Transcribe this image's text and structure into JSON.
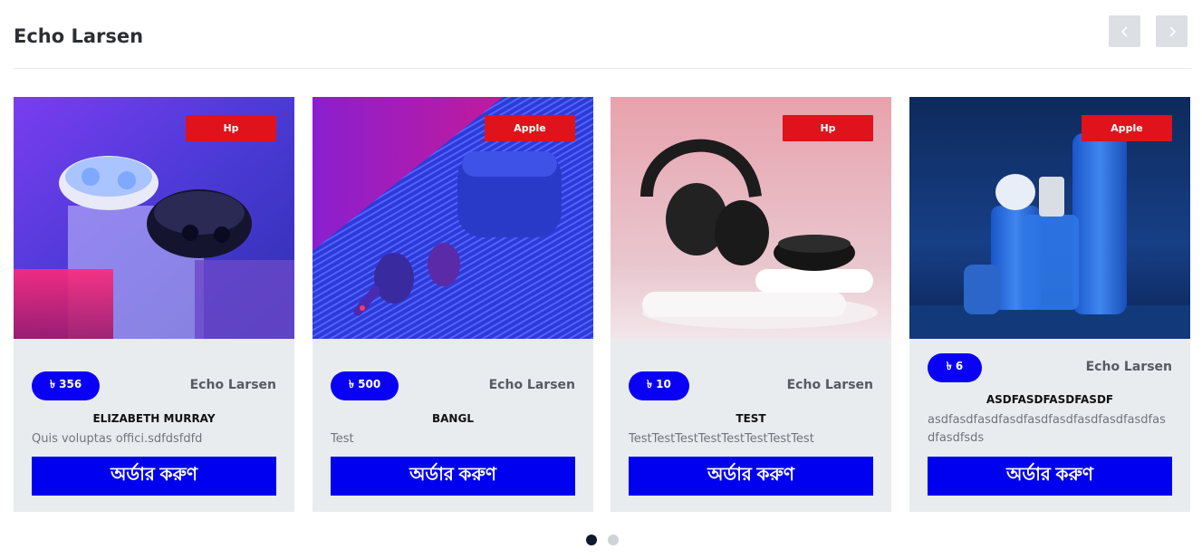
{
  "section": {
    "title": "Echo Larsen"
  },
  "nav": {
    "prev_icon": "chevron-left-icon",
    "next_icon": "chevron-right-icon"
  },
  "products": [
    {
      "brand": "Hp",
      "price": "৳ 356",
      "seller": "Echo Larsen",
      "name": "ELIZABETH MURRAY",
      "description": "Quis voluptas offici.sdfdsfdfd",
      "order_label": "অর্ডার করুণ",
      "image": "earbuds-case-photo"
    },
    {
      "brand": "Apple",
      "price": "৳ 500",
      "seller": "Echo Larsen",
      "name": "BANGL",
      "description": "Test",
      "order_label": "অর্ডার করুণ",
      "image": "airpods-photo"
    },
    {
      "brand": "Hp",
      "price": "৳ 10",
      "seller": "Echo Larsen",
      "name": "TEST",
      "description": "TestTestTestTestTestTestTestTest",
      "order_label": "অর্ডার করুণ",
      "image": "headphones-photo"
    },
    {
      "brand": "Apple",
      "price": "৳ 6",
      "seller": "Echo Larsen",
      "name": "ASDFASDFASDFASDF",
      "description": "asdfasdfasdfasdfasdfasdfasdfasdfasdfasdfasdfsds",
      "order_label": "অর্ডার করুণ",
      "image": "cosmetics-bottles-photo"
    }
  ],
  "pagination": {
    "pages": 2,
    "active": 1
  },
  "colors": {
    "accent": "#0000f0",
    "badge": "#e0121c",
    "card_bg": "#e9ecef"
  }
}
